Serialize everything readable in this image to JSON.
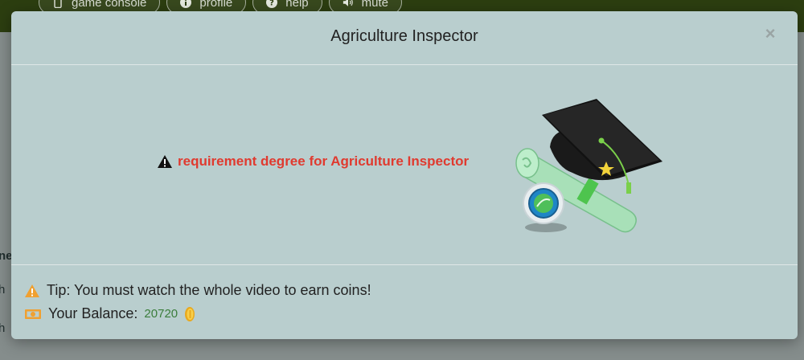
{
  "nav": {
    "items": [
      {
        "label": "game console",
        "icon": "mobile-icon"
      },
      {
        "label": "profile",
        "icon": "info-icon"
      },
      {
        "label": "help",
        "icon": "question-icon"
      },
      {
        "label": "mute",
        "icon": "speaker-icon"
      }
    ]
  },
  "background": {
    "fragments": [
      "ne",
      "h",
      "h"
    ]
  },
  "modal": {
    "title": "Agriculture Inspector",
    "close_label": "×",
    "requirement_text": "requirement degree for Agriculture Inspector",
    "tip_text": "Tip: You must watch the whole video to earn coins!",
    "balance_label": "Your Balance:",
    "balance_value": "20720"
  },
  "colors": {
    "requirement": "#e03a2f",
    "warning_orange": "#f0a030",
    "balance_green": "#3b7d3b",
    "modal_bg": "#b9cece"
  }
}
